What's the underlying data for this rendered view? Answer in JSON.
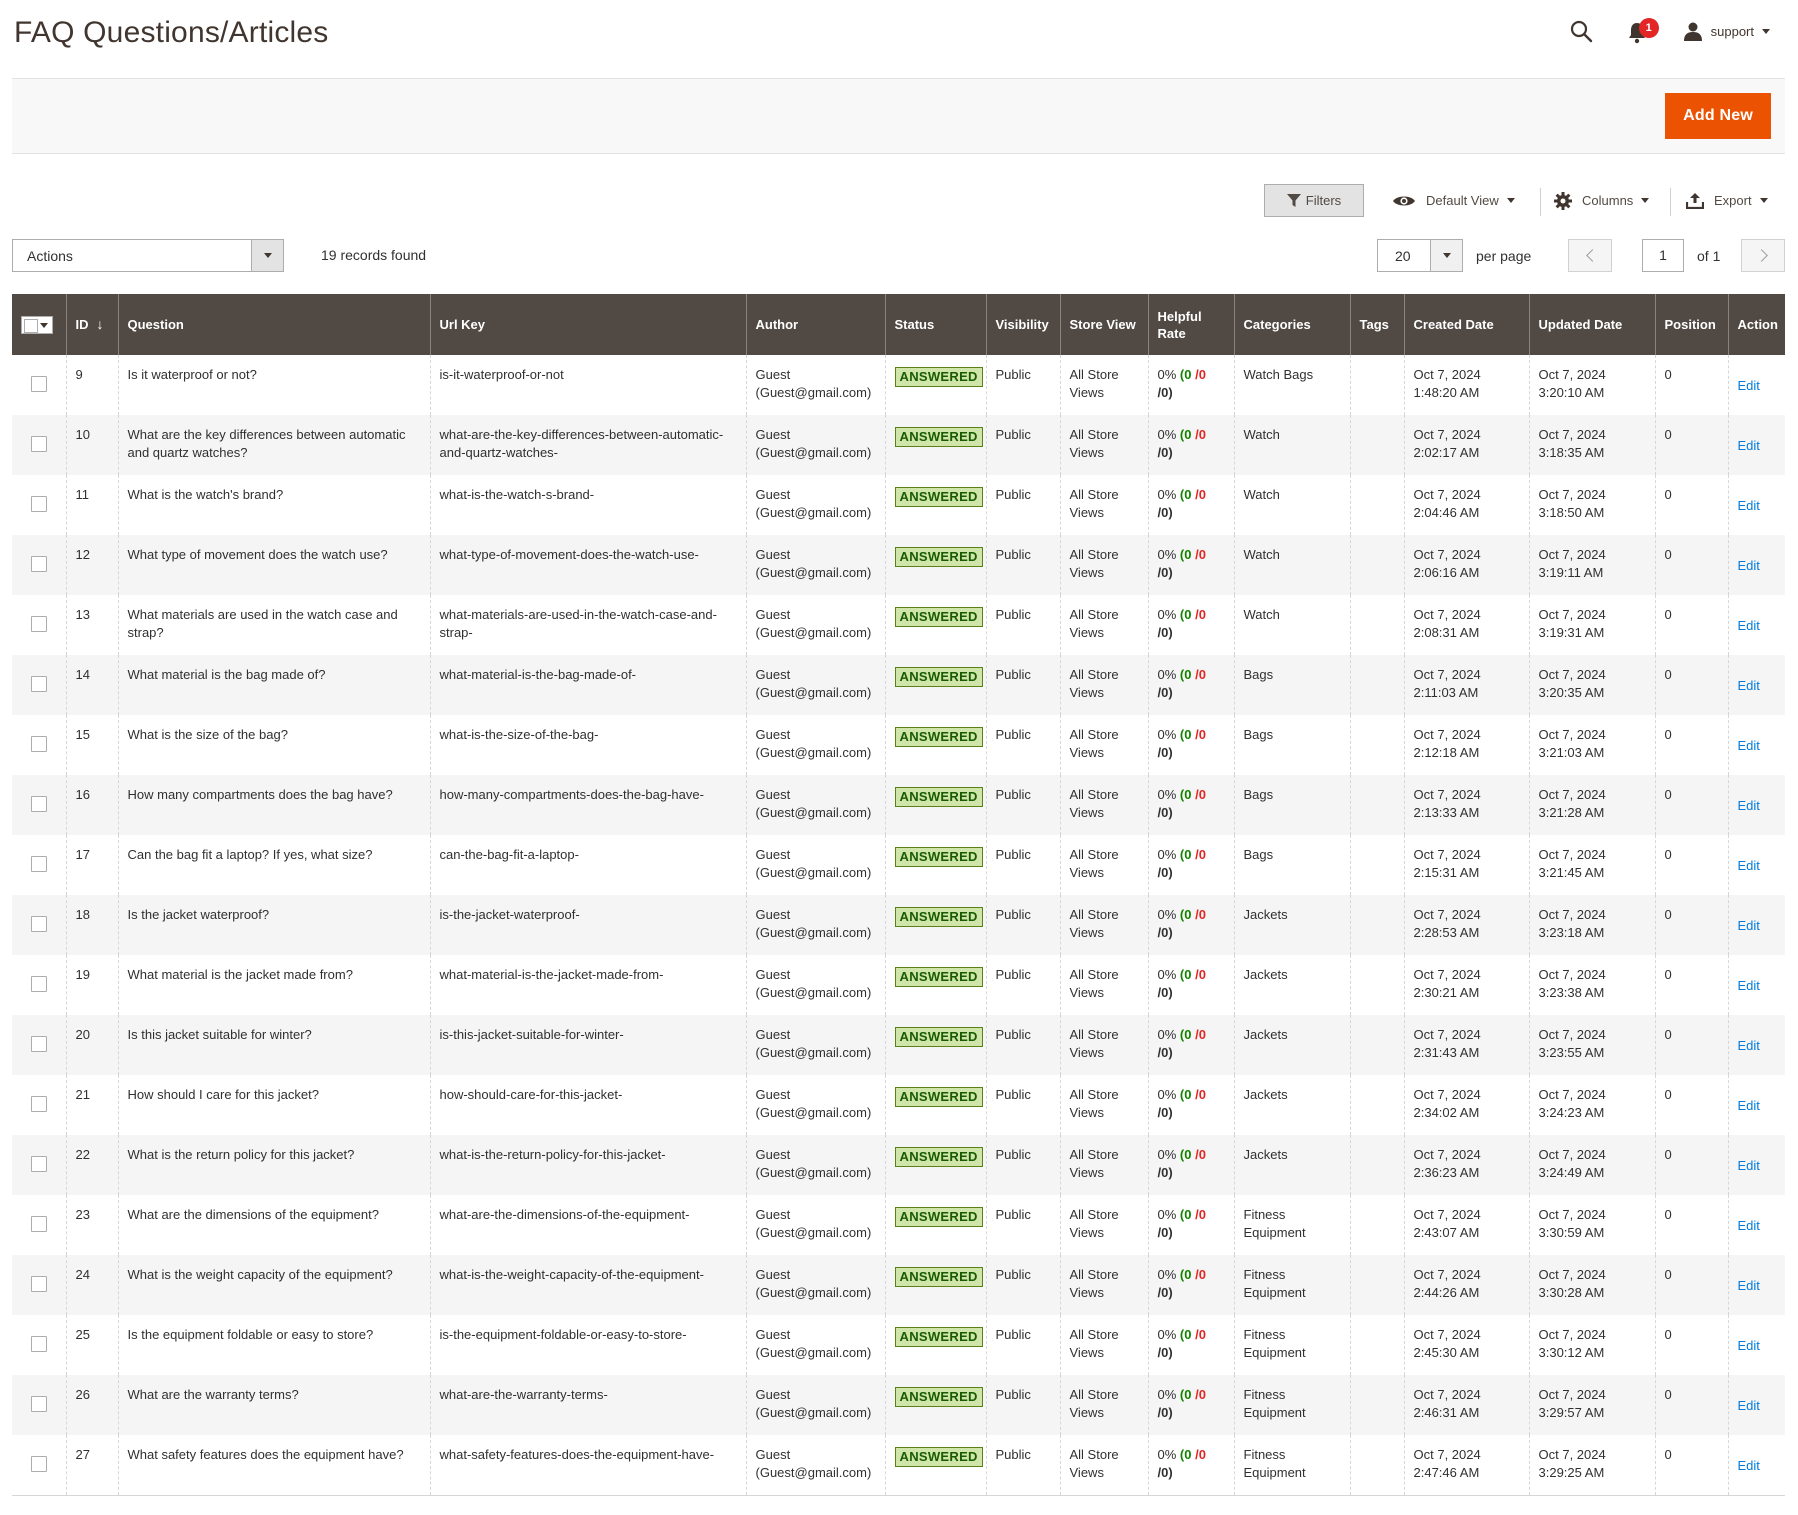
{
  "header": {
    "title": "FAQ Questions/Articles",
    "notification_count": "1",
    "user_name": "support"
  },
  "action_bar": {
    "add_new_label": "Add New"
  },
  "controls": {
    "filters_label": "Filters",
    "view_label": "Default View",
    "columns_label": "Columns",
    "export_label": "Export"
  },
  "toolbar": {
    "actions_label": "Actions",
    "records_found": "19 records found",
    "per_page_value": "20",
    "per_page_label": "per page",
    "current_page": "1",
    "of_label": "of 1"
  },
  "columns": [
    "ID",
    "Question",
    "Url Key",
    "Author",
    "Status",
    "Visibility",
    "Store View",
    "Helpful Rate",
    "Categories",
    "Tags",
    "Created Date",
    "Updated Date",
    "Position",
    "Action"
  ],
  "rows": [
    {
      "id": "9",
      "question": "Is it waterproof or not?",
      "url_key": "is-it-waterproof-or-not",
      "author": "Guest (Guest@gmail.com)",
      "status": "ANSWERED",
      "visibility": "Public",
      "store_view": "All Store Views",
      "rate_pct": "0%",
      "rate_yes": "0",
      "rate_no": "0",
      "rate_total": "0",
      "categories": "Watch Bags",
      "tags": "",
      "created": "Oct 7, 2024 1:48:20 AM",
      "updated": "Oct 7, 2024 3:20:10 AM",
      "position": "0",
      "action": "Edit"
    },
    {
      "id": "10",
      "question": "What are the key differences between automatic and quartz watches?",
      "url_key": "what-are-the-key-differences-between-automatic-and-quartz-watches-",
      "author": "Guest (Guest@gmail.com)",
      "status": "ANSWERED",
      "visibility": "Public",
      "store_view": "All Store Views",
      "rate_pct": "0%",
      "rate_yes": "0",
      "rate_no": "0",
      "rate_total": "0",
      "categories": "Watch",
      "tags": "",
      "created": "Oct 7, 2024 2:02:17 AM",
      "updated": "Oct 7, 2024 3:18:35 AM",
      "position": "0",
      "action": "Edit"
    },
    {
      "id": "11",
      "question": "What is the watch's brand?",
      "url_key": "what-is-the-watch-s-brand-",
      "author": "Guest (Guest@gmail.com)",
      "status": "ANSWERED",
      "visibility": "Public",
      "store_view": "All Store Views",
      "rate_pct": "0%",
      "rate_yes": "0",
      "rate_no": "0",
      "rate_total": "0",
      "categories": "Watch",
      "tags": "",
      "created": "Oct 7, 2024 2:04:46 AM",
      "updated": "Oct 7, 2024 3:18:50 AM",
      "position": "0",
      "action": "Edit"
    },
    {
      "id": "12",
      "question": "What type of movement does the watch use?",
      "url_key": "what-type-of-movement-does-the-watch-use-",
      "author": "Guest (Guest@gmail.com)",
      "status": "ANSWERED",
      "visibility": "Public",
      "store_view": "All Store Views",
      "rate_pct": "0%",
      "rate_yes": "0",
      "rate_no": "0",
      "rate_total": "0",
      "categories": "Watch",
      "tags": "",
      "created": "Oct 7, 2024 2:06:16 AM",
      "updated": "Oct 7, 2024 3:19:11 AM",
      "position": "0",
      "action": "Edit"
    },
    {
      "id": "13",
      "question": "What materials are used in the watch case and strap?",
      "url_key": "what-materials-are-used-in-the-watch-case-and-strap-",
      "author": "Guest (Guest@gmail.com)",
      "status": "ANSWERED",
      "visibility": "Public",
      "store_view": "All Store Views",
      "rate_pct": "0%",
      "rate_yes": "0",
      "rate_no": "0",
      "rate_total": "0",
      "categories": "Watch",
      "tags": "",
      "created": "Oct 7, 2024 2:08:31 AM",
      "updated": "Oct 7, 2024 3:19:31 AM",
      "position": "0",
      "action": "Edit"
    },
    {
      "id": "14",
      "question": "What material is the bag made of?",
      "url_key": "what-material-is-the-bag-made-of-",
      "author": "Guest (Guest@gmail.com)",
      "status": "ANSWERED",
      "visibility": "Public",
      "store_view": "All Store Views",
      "rate_pct": "0%",
      "rate_yes": "0",
      "rate_no": "0",
      "rate_total": "0",
      "categories": "Bags",
      "tags": "",
      "created": "Oct 7, 2024 2:11:03 AM",
      "updated": "Oct 7, 2024 3:20:35 AM",
      "position": "0",
      "action": "Edit"
    },
    {
      "id": "15",
      "question": "What is the size of the bag?",
      "url_key": "what-is-the-size-of-the-bag-",
      "author": "Guest (Guest@gmail.com)",
      "status": "ANSWERED",
      "visibility": "Public",
      "store_view": "All Store Views",
      "rate_pct": "0%",
      "rate_yes": "0",
      "rate_no": "0",
      "rate_total": "0",
      "categories": "Bags",
      "tags": "",
      "created": "Oct 7, 2024 2:12:18 AM",
      "updated": "Oct 7, 2024 3:21:03 AM",
      "position": "0",
      "action": "Edit"
    },
    {
      "id": "16",
      "question": "How many compartments does the bag have?",
      "url_key": "how-many-compartments-does-the-bag-have-",
      "author": "Guest (Guest@gmail.com)",
      "status": "ANSWERED",
      "visibility": "Public",
      "store_view": "All Store Views",
      "rate_pct": "0%",
      "rate_yes": "0",
      "rate_no": "0",
      "rate_total": "0",
      "categories": "Bags",
      "tags": "",
      "created": "Oct 7, 2024 2:13:33 AM",
      "updated": "Oct 7, 2024 3:21:28 AM",
      "position": "0",
      "action": "Edit"
    },
    {
      "id": "17",
      "question": "Can the bag fit a laptop? If yes, what size?",
      "url_key": "can-the-bag-fit-a-laptop-",
      "author": "Guest (Guest@gmail.com)",
      "status": "ANSWERED",
      "visibility": "Public",
      "store_view": "All Store Views",
      "rate_pct": "0%",
      "rate_yes": "0",
      "rate_no": "0",
      "rate_total": "0",
      "categories": "Bags",
      "tags": "",
      "created": "Oct 7, 2024 2:15:31 AM",
      "updated": "Oct 7, 2024 3:21:45 AM",
      "position": "0",
      "action": "Edit"
    },
    {
      "id": "18",
      "question": "Is the jacket waterproof?",
      "url_key": "is-the-jacket-waterproof-",
      "author": "Guest (Guest@gmail.com)",
      "status": "ANSWERED",
      "visibility": "Public",
      "store_view": "All Store Views",
      "rate_pct": "0%",
      "rate_yes": "0",
      "rate_no": "0",
      "rate_total": "0",
      "categories": "Jackets",
      "tags": "",
      "created": "Oct 7, 2024 2:28:53 AM",
      "updated": "Oct 7, 2024 3:23:18 AM",
      "position": "0",
      "action": "Edit"
    },
    {
      "id": "19",
      "question": "What material is the jacket made from?",
      "url_key": "what-material-is-the-jacket-made-from-",
      "author": "Guest (Guest@gmail.com)",
      "status": "ANSWERED",
      "visibility": "Public",
      "store_view": "All Store Views",
      "rate_pct": "0%",
      "rate_yes": "0",
      "rate_no": "0",
      "rate_total": "0",
      "categories": "Jackets",
      "tags": "",
      "created": "Oct 7, 2024 2:30:21 AM",
      "updated": "Oct 7, 2024 3:23:38 AM",
      "position": "0",
      "action": "Edit"
    },
    {
      "id": "20",
      "question": "Is this jacket suitable for winter?",
      "url_key": "is-this-jacket-suitable-for-winter-",
      "author": "Guest (Guest@gmail.com)",
      "status": "ANSWERED",
      "visibility": "Public",
      "store_view": "All Store Views",
      "rate_pct": "0%",
      "rate_yes": "0",
      "rate_no": "0",
      "rate_total": "0",
      "categories": "Jackets",
      "tags": "",
      "created": "Oct 7, 2024 2:31:43 AM",
      "updated": "Oct 7, 2024 3:23:55 AM",
      "position": "0",
      "action": "Edit"
    },
    {
      "id": "21",
      "question": "How should I care for this jacket?",
      "url_key": "how-should-care-for-this-jacket-",
      "author": "Guest (Guest@gmail.com)",
      "status": "ANSWERED",
      "visibility": "Public",
      "store_view": "All Store Views",
      "rate_pct": "0%",
      "rate_yes": "0",
      "rate_no": "0",
      "rate_total": "0",
      "categories": "Jackets",
      "tags": "",
      "created": "Oct 7, 2024 2:34:02 AM",
      "updated": "Oct 7, 2024 3:24:23 AM",
      "position": "0",
      "action": "Edit"
    },
    {
      "id": "22",
      "question": "What is the return policy for this jacket?",
      "url_key": "what-is-the-return-policy-for-this-jacket-",
      "author": "Guest (Guest@gmail.com)",
      "status": "ANSWERED",
      "visibility": "Public",
      "store_view": "All Store Views",
      "rate_pct": "0%",
      "rate_yes": "0",
      "rate_no": "0",
      "rate_total": "0",
      "categories": "Jackets",
      "tags": "",
      "created": "Oct 7, 2024 2:36:23 AM",
      "updated": "Oct 7, 2024 3:24:49 AM",
      "position": "0",
      "action": "Edit"
    },
    {
      "id": "23",
      "question": "What are the dimensions of the equipment?",
      "url_key": "what-are-the-dimensions-of-the-equipment-",
      "author": "Guest (Guest@gmail.com)",
      "status": "ANSWERED",
      "visibility": "Public",
      "store_view": "All Store Views",
      "rate_pct": "0%",
      "rate_yes": "0",
      "rate_no": "0",
      "rate_total": "0",
      "categories": "Fitness Equipment",
      "tags": "",
      "created": "Oct 7, 2024 2:43:07 AM",
      "updated": "Oct 7, 2024 3:30:59 AM",
      "position": "0",
      "action": "Edit"
    },
    {
      "id": "24",
      "question": "What is the weight capacity of the equipment?",
      "url_key": "what-is-the-weight-capacity-of-the-equipment-",
      "author": "Guest (Guest@gmail.com)",
      "status": "ANSWERED",
      "visibility": "Public",
      "store_view": "All Store Views",
      "rate_pct": "0%",
      "rate_yes": "0",
      "rate_no": "0",
      "rate_total": "0",
      "categories": "Fitness Equipment",
      "tags": "",
      "created": "Oct 7, 2024 2:44:26 AM",
      "updated": "Oct 7, 2024 3:30:28 AM",
      "position": "0",
      "action": "Edit"
    },
    {
      "id": "25",
      "question": "Is the equipment foldable or easy to store?",
      "url_key": "is-the-equipment-foldable-or-easy-to-store-",
      "author": "Guest (Guest@gmail.com)",
      "status": "ANSWERED",
      "visibility": "Public",
      "store_view": "All Store Views",
      "rate_pct": "0%",
      "rate_yes": "0",
      "rate_no": "0",
      "rate_total": "0",
      "categories": "Fitness Equipment",
      "tags": "",
      "created": "Oct 7, 2024 2:45:30 AM",
      "updated": "Oct 7, 2024 3:30:12 AM",
      "position": "0",
      "action": "Edit"
    },
    {
      "id": "26",
      "question": "What are the warranty terms?",
      "url_key": "what-are-the-warranty-terms-",
      "author": "Guest (Guest@gmail.com)",
      "status": "ANSWERED",
      "visibility": "Public",
      "store_view": "All Store Views",
      "rate_pct": "0%",
      "rate_yes": "0",
      "rate_no": "0",
      "rate_total": "0",
      "categories": "Fitness Equipment",
      "tags": "",
      "created": "Oct 7, 2024 2:46:31 AM",
      "updated": "Oct 7, 2024 3:29:57 AM",
      "position": "0",
      "action": "Edit"
    },
    {
      "id": "27",
      "question": "What safety features does the equipment have?",
      "url_key": "what-safety-features-does-the-equipment-have-",
      "author": "Guest (Guest@gmail.com)",
      "status": "ANSWERED",
      "visibility": "Public",
      "store_view": "All Store Views",
      "rate_pct": "0%",
      "rate_yes": "0",
      "rate_no": "0",
      "rate_total": "0",
      "categories": "Fitness Equipment",
      "tags": "",
      "created": "Oct 7, 2024 2:47:46 AM",
      "updated": "Oct 7, 2024 3:29:25 AM",
      "position": "0",
      "action": "Edit"
    }
  ],
  "colors": {
    "accent": "#eb5202",
    "header_bg": "#514943",
    "link": "#007bdb",
    "answered_bg": "#d0e5a9",
    "answered_text": "#185b00",
    "rate_yes": "#138200",
    "rate_no": "#e22626"
  }
}
